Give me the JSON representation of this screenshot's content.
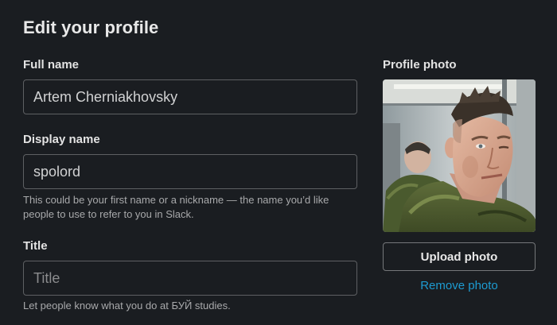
{
  "dialog": {
    "title": "Edit your profile"
  },
  "form": {
    "full_name": {
      "label": "Full name",
      "value": "Artem Cherniakhovsky"
    },
    "display_name": {
      "label": "Display name",
      "value": "spolord",
      "hint": "This could be your first name or a nickname — the name you’d like people to use to refer to you in Slack."
    },
    "title": {
      "label": "Title",
      "value": "",
      "placeholder": "Title",
      "hint": "Let people know what you do at БУЙ studies."
    }
  },
  "profile_photo": {
    "label": "Profile photo",
    "upload_label": "Upload photo",
    "remove_label": "Remove photo"
  },
  "colors": {
    "background": "#1a1d21",
    "link": "#1d9bd1",
    "border": "#5e6063"
  }
}
